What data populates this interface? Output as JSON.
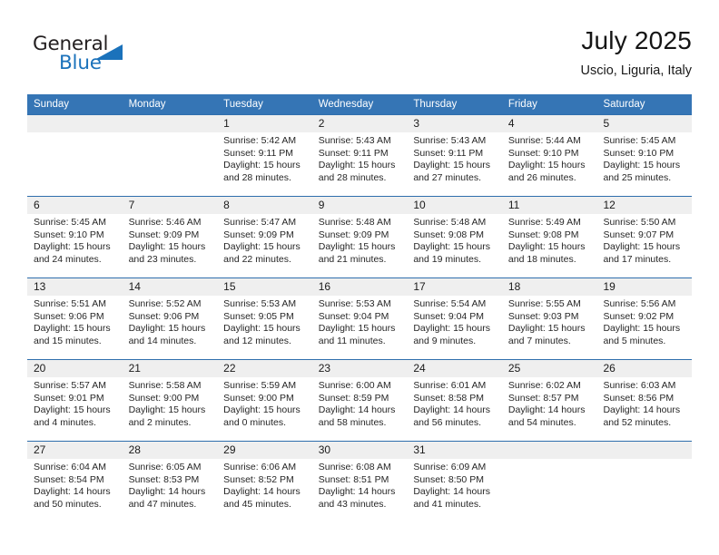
{
  "brand": {
    "name_part1": "General",
    "name_part2": "Blue",
    "triangle_icon": "triangle-icon",
    "accent_color": "#1b72bb"
  },
  "header": {
    "month_title": "July 2025",
    "location": "Uscio, Liguria, Italy"
  },
  "theme": {
    "header_blue": "#3575b5",
    "row_divider_blue": "#2f6ead",
    "number_band_gray": "#efefef",
    "text_color": "#262626"
  },
  "calendar": {
    "weekday_headers": [
      "Sunday",
      "Monday",
      "Tuesday",
      "Wednesday",
      "Thursday",
      "Friday",
      "Saturday"
    ],
    "weeks": [
      {
        "days": [
          {
            "num": "",
            "sunrise": "",
            "sunset": "",
            "daylight1": "",
            "daylight2": ""
          },
          {
            "num": "",
            "sunrise": "",
            "sunset": "",
            "daylight1": "",
            "daylight2": ""
          },
          {
            "num": "1",
            "sunrise": "Sunrise: 5:42 AM",
            "sunset": "Sunset: 9:11 PM",
            "daylight1": "Daylight: 15 hours",
            "daylight2": "and 28 minutes."
          },
          {
            "num": "2",
            "sunrise": "Sunrise: 5:43 AM",
            "sunset": "Sunset: 9:11 PM",
            "daylight1": "Daylight: 15 hours",
            "daylight2": "and 28 minutes."
          },
          {
            "num": "3",
            "sunrise": "Sunrise: 5:43 AM",
            "sunset": "Sunset: 9:11 PM",
            "daylight1": "Daylight: 15 hours",
            "daylight2": "and 27 minutes."
          },
          {
            "num": "4",
            "sunrise": "Sunrise: 5:44 AM",
            "sunset": "Sunset: 9:10 PM",
            "daylight1": "Daylight: 15 hours",
            "daylight2": "and 26 minutes."
          },
          {
            "num": "5",
            "sunrise": "Sunrise: 5:45 AM",
            "sunset": "Sunset: 9:10 PM",
            "daylight1": "Daylight: 15 hours",
            "daylight2": "and 25 minutes."
          }
        ]
      },
      {
        "days": [
          {
            "num": "6",
            "sunrise": "Sunrise: 5:45 AM",
            "sunset": "Sunset: 9:10 PM",
            "daylight1": "Daylight: 15 hours",
            "daylight2": "and 24 minutes."
          },
          {
            "num": "7",
            "sunrise": "Sunrise: 5:46 AM",
            "sunset": "Sunset: 9:09 PM",
            "daylight1": "Daylight: 15 hours",
            "daylight2": "and 23 minutes."
          },
          {
            "num": "8",
            "sunrise": "Sunrise: 5:47 AM",
            "sunset": "Sunset: 9:09 PM",
            "daylight1": "Daylight: 15 hours",
            "daylight2": "and 22 minutes."
          },
          {
            "num": "9",
            "sunrise": "Sunrise: 5:48 AM",
            "sunset": "Sunset: 9:09 PM",
            "daylight1": "Daylight: 15 hours",
            "daylight2": "and 21 minutes."
          },
          {
            "num": "10",
            "sunrise": "Sunrise: 5:48 AM",
            "sunset": "Sunset: 9:08 PM",
            "daylight1": "Daylight: 15 hours",
            "daylight2": "and 19 minutes."
          },
          {
            "num": "11",
            "sunrise": "Sunrise: 5:49 AM",
            "sunset": "Sunset: 9:08 PM",
            "daylight1": "Daylight: 15 hours",
            "daylight2": "and 18 minutes."
          },
          {
            "num": "12",
            "sunrise": "Sunrise: 5:50 AM",
            "sunset": "Sunset: 9:07 PM",
            "daylight1": "Daylight: 15 hours",
            "daylight2": "and 17 minutes."
          }
        ]
      },
      {
        "days": [
          {
            "num": "13",
            "sunrise": "Sunrise: 5:51 AM",
            "sunset": "Sunset: 9:06 PM",
            "daylight1": "Daylight: 15 hours",
            "daylight2": "and 15 minutes."
          },
          {
            "num": "14",
            "sunrise": "Sunrise: 5:52 AM",
            "sunset": "Sunset: 9:06 PM",
            "daylight1": "Daylight: 15 hours",
            "daylight2": "and 14 minutes."
          },
          {
            "num": "15",
            "sunrise": "Sunrise: 5:53 AM",
            "sunset": "Sunset: 9:05 PM",
            "daylight1": "Daylight: 15 hours",
            "daylight2": "and 12 minutes."
          },
          {
            "num": "16",
            "sunrise": "Sunrise: 5:53 AM",
            "sunset": "Sunset: 9:04 PM",
            "daylight1": "Daylight: 15 hours",
            "daylight2": "and 11 minutes."
          },
          {
            "num": "17",
            "sunrise": "Sunrise: 5:54 AM",
            "sunset": "Sunset: 9:04 PM",
            "daylight1": "Daylight: 15 hours",
            "daylight2": "and 9 minutes."
          },
          {
            "num": "18",
            "sunrise": "Sunrise: 5:55 AM",
            "sunset": "Sunset: 9:03 PM",
            "daylight1": "Daylight: 15 hours",
            "daylight2": "and 7 minutes."
          },
          {
            "num": "19",
            "sunrise": "Sunrise: 5:56 AM",
            "sunset": "Sunset: 9:02 PM",
            "daylight1": "Daylight: 15 hours",
            "daylight2": "and 5 minutes."
          }
        ]
      },
      {
        "days": [
          {
            "num": "20",
            "sunrise": "Sunrise: 5:57 AM",
            "sunset": "Sunset: 9:01 PM",
            "daylight1": "Daylight: 15 hours",
            "daylight2": "and 4 minutes."
          },
          {
            "num": "21",
            "sunrise": "Sunrise: 5:58 AM",
            "sunset": "Sunset: 9:00 PM",
            "daylight1": "Daylight: 15 hours",
            "daylight2": "and 2 minutes."
          },
          {
            "num": "22",
            "sunrise": "Sunrise: 5:59 AM",
            "sunset": "Sunset: 9:00 PM",
            "daylight1": "Daylight: 15 hours",
            "daylight2": "and 0 minutes."
          },
          {
            "num": "23",
            "sunrise": "Sunrise: 6:00 AM",
            "sunset": "Sunset: 8:59 PM",
            "daylight1": "Daylight: 14 hours",
            "daylight2": "and 58 minutes."
          },
          {
            "num": "24",
            "sunrise": "Sunrise: 6:01 AM",
            "sunset": "Sunset: 8:58 PM",
            "daylight1": "Daylight: 14 hours",
            "daylight2": "and 56 minutes."
          },
          {
            "num": "25",
            "sunrise": "Sunrise: 6:02 AM",
            "sunset": "Sunset: 8:57 PM",
            "daylight1": "Daylight: 14 hours",
            "daylight2": "and 54 minutes."
          },
          {
            "num": "26",
            "sunrise": "Sunrise: 6:03 AM",
            "sunset": "Sunset: 8:56 PM",
            "daylight1": "Daylight: 14 hours",
            "daylight2": "and 52 minutes."
          }
        ]
      },
      {
        "days": [
          {
            "num": "27",
            "sunrise": "Sunrise: 6:04 AM",
            "sunset": "Sunset: 8:54 PM",
            "daylight1": "Daylight: 14 hours",
            "daylight2": "and 50 minutes."
          },
          {
            "num": "28",
            "sunrise": "Sunrise: 6:05 AM",
            "sunset": "Sunset: 8:53 PM",
            "daylight1": "Daylight: 14 hours",
            "daylight2": "and 47 minutes."
          },
          {
            "num": "29",
            "sunrise": "Sunrise: 6:06 AM",
            "sunset": "Sunset: 8:52 PM",
            "daylight1": "Daylight: 14 hours",
            "daylight2": "and 45 minutes."
          },
          {
            "num": "30",
            "sunrise": "Sunrise: 6:08 AM",
            "sunset": "Sunset: 8:51 PM",
            "daylight1": "Daylight: 14 hours",
            "daylight2": "and 43 minutes."
          },
          {
            "num": "31",
            "sunrise": "Sunrise: 6:09 AM",
            "sunset": "Sunset: 8:50 PM",
            "daylight1": "Daylight: 14 hours",
            "daylight2": "and 41 minutes."
          },
          {
            "num": "",
            "sunrise": "",
            "sunset": "",
            "daylight1": "",
            "daylight2": ""
          },
          {
            "num": "",
            "sunrise": "",
            "sunset": "",
            "daylight1": "",
            "daylight2": ""
          }
        ]
      }
    ]
  }
}
